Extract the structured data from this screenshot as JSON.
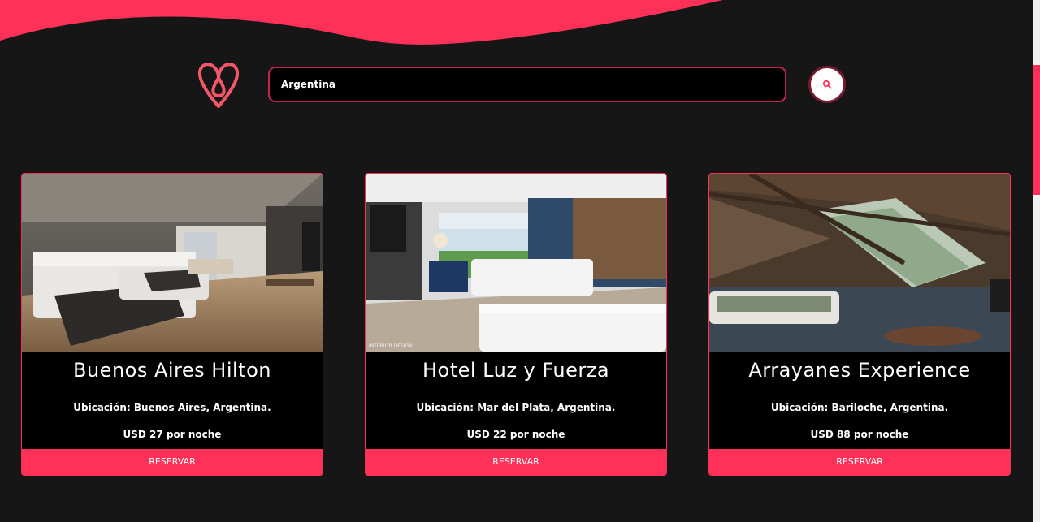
{
  "theme": {
    "accent": "#ff3158",
    "background": "#171617",
    "card_background": "#000000"
  },
  "header": {
    "logo_icon": "heart-loop-logo-icon"
  },
  "search": {
    "value": "Argentina",
    "button_icon": "search-icon"
  },
  "hotels": [
    {
      "name": "Buenos Aires Hilton",
      "location": "Ubicación: Buenos Aires, Argentina.",
      "price": "USD 27 por noche",
      "button_label": "RESERVAR",
      "image": "hotel-room-photo"
    },
    {
      "name": "Hotel Luz y Fuerza",
      "location": "Ubicación: Mar del Plata, Argentina.",
      "price": "USD 22 por noche",
      "button_label": "RESERVAR",
      "image": "hotel-room-sea-view-photo",
      "image_watermark": "INTERIOR DESIGN"
    },
    {
      "name": "Arrayanes Experience",
      "location": "Ubicación: Bariloche, Argentina.",
      "price": "USD 88 por noche",
      "button_label": "RESERVAR",
      "image": "attic-cabin-room-photo"
    }
  ]
}
